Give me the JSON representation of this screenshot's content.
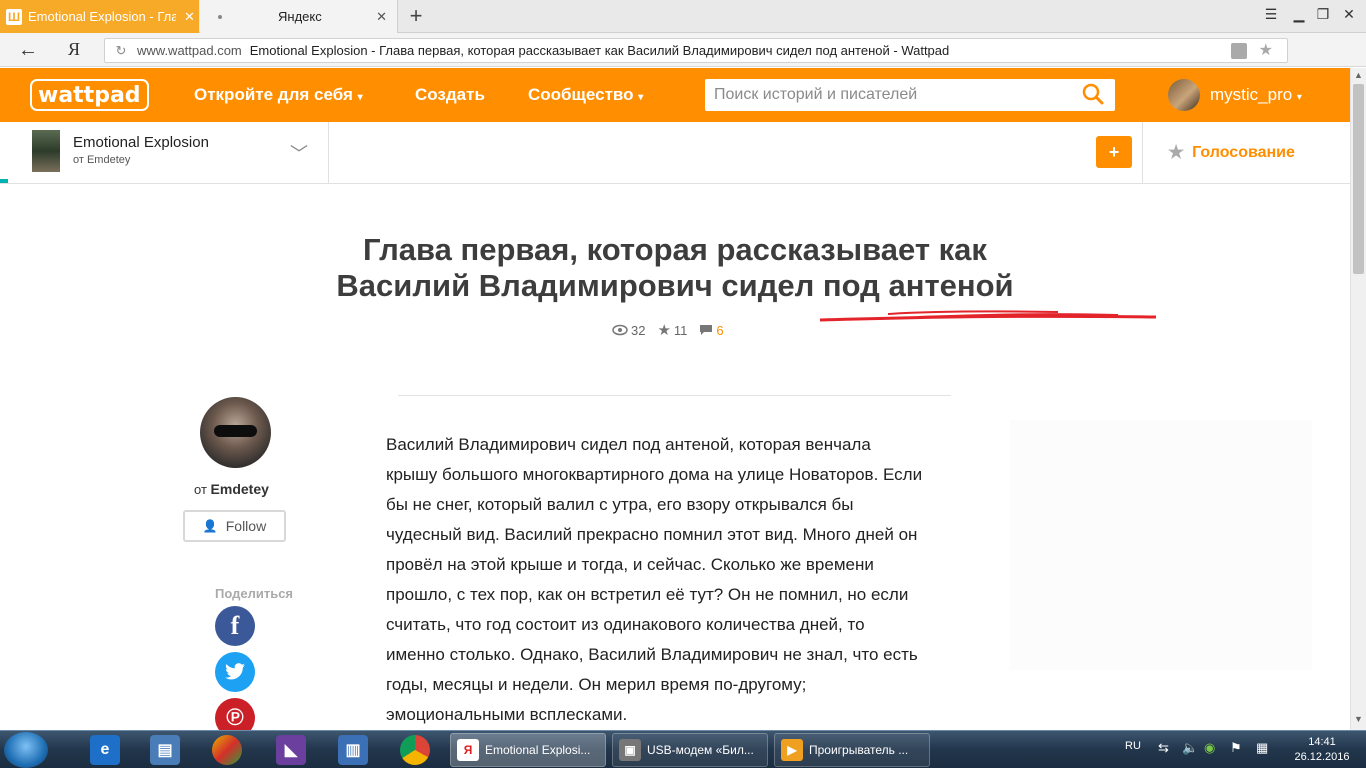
{
  "browser": {
    "active_tab_title": "Emotional Explosion - Глава первая",
    "active_tab_favicon": "Ш",
    "other_tab_title": "Яндекс",
    "new_tab": "+",
    "close": "✕",
    "back": "←",
    "yandex_logo": "Я",
    "reload": "↻",
    "url_host": "www.wattpad.com",
    "url_title": "Emotional Explosion - Глава первая, которая рассказывает как Василий Владимирович сидел под антеной - Wattpad"
  },
  "wattpad": {
    "logo": "wattpad",
    "nav": {
      "discover": "Откройте для себя",
      "create": "Создать",
      "community": "Сообщество"
    },
    "search_placeholder": "Поиск историй и писателей",
    "username": "mystic_pro",
    "brand_color": "#ff8f00"
  },
  "story": {
    "title": "Emotional Explosion",
    "author_line": "от Emdetey",
    "add_label": "+",
    "vote_label": "Голосование"
  },
  "chapter": {
    "title": "Глава первая, которая рассказывает как Василий Владимирович сидел под антеной",
    "views": "32",
    "votes": "11",
    "comments": "6",
    "author_prefix": "от",
    "author_name": "Emdetey",
    "follow_label": "Follow",
    "share_label": "Поделиться",
    "text": "Василий Владимирович сидел под антеной, которая венчала крышу большого многоквартирного дома на улице Новаторов. Если бы не снег, который валил с утра, его взору открывался бы чудесный вид. Василий прекрасно помнил этот вид. Много дней он провёл на этой крыше и тогда, и сейчас. Сколько же времени прошло, с тех пор, как он встретил её тут? Он не помнил, но если считать, что год состоит из одинакового количества дней, то именно столько. Однако, Василий Владимирович не знал, что есть годы, месяцы и недели. Он мерил время по-другому; эмоциональными всплесками."
  },
  "taskbar": {
    "tasks": [
      {
        "label": "Emotional Explosi...",
        "icon": "Я"
      },
      {
        "label": "USB-модем «Бил...",
        "icon": "▣"
      },
      {
        "label": "Проигрыватель ...",
        "icon": "▶"
      }
    ],
    "lang": "RU",
    "time": "14:41",
    "date": "26.12.2016"
  }
}
